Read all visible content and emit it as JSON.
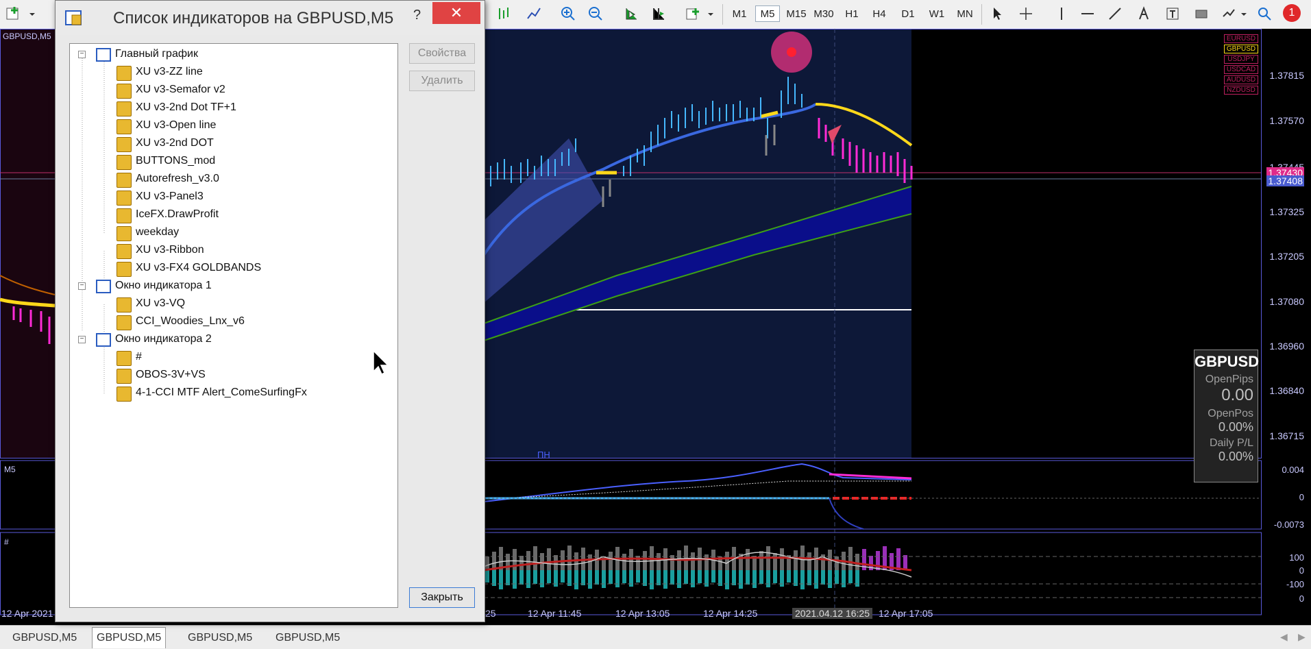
{
  "toolbar": {
    "timeframes": [
      "M1",
      "M5",
      "M15",
      "M30",
      "H1",
      "H4",
      "D1",
      "W1",
      "MN"
    ],
    "selected_timeframe": "M5",
    "notification_count": "1"
  },
  "chart": {
    "symbol_label": "GBPUSD,M5",
    "price_labels": [
      "1.37815",
      "1.37570",
      "1.37445",
      "1.37430",
      "1.37408",
      "1.37325",
      "1.37205",
      "1.37080",
      "1.36960",
      "1.36840",
      "1.36715"
    ],
    "time_labels": [
      "12 Apr 2021",
      "25",
      "12 Apr 11:45",
      "12 Apr 13:05",
      "12 Apr 14:25",
      "2021.04.12 16:25",
      "12 Apr 17:05"
    ],
    "day_marker": "ПН",
    "sub1_label": "M5",
    "sub1_levels": [
      "0.004",
      "0",
      "-0.0073"
    ],
    "sub2_label": "#",
    "sub2_levels": [
      "100",
      "0",
      "-100",
      "0"
    ],
    "symbols": [
      "EURUSD",
      "GBPUSD",
      "USDJPY",
      "USDCAD",
      "AUDUSD",
      "NZDUSD"
    ],
    "panel": {
      "title": "GBPUSD",
      "open_pips_label": "OpenPips",
      "open_pips_value": "0.00",
      "open_pos_label": "OpenPos",
      "open_pos_value": "0.00%",
      "daily_label": "Daily P/L",
      "daily_value": "0.00%"
    }
  },
  "tabs": [
    "GBPUSD,M5",
    "GBPUSD,M5",
    "GBPUSD,M5",
    "GBPUSD,M5"
  ],
  "dialog": {
    "title": "Список индикаторов на GBPUSD,M5",
    "help": "?",
    "btn_properties": "Свойства",
    "btn_delete": "Удалить",
    "btn_close": "Закрыть",
    "groups": [
      {
        "name": "Главный график",
        "items": [
          "XU v3-ZZ line",
          "XU v3-Semafor v2",
          "XU v3-2nd Dot TF+1",
          "XU v3-Open line",
          "XU v3-2nd DOT",
          "BUTTONS_mod",
          "Autorefresh_v3.0",
          "XU v3-Panel3",
          "IceFX.DrawProfit",
          "weekday",
          "XU v3-Ribbon",
          "XU v3-FX4 GOLDBANDS"
        ]
      },
      {
        "name": "Окно индикатора 1",
        "items": [
          "XU v3-VQ",
          "CCI_Woodies_Lnx_v6"
        ]
      },
      {
        "name": "Окно индикатора 2",
        "items": [
          "#",
          "OBOS-3V+VS",
          "4-1-CCI MTF  Alert_ComeSurfingFx"
        ]
      }
    ]
  }
}
